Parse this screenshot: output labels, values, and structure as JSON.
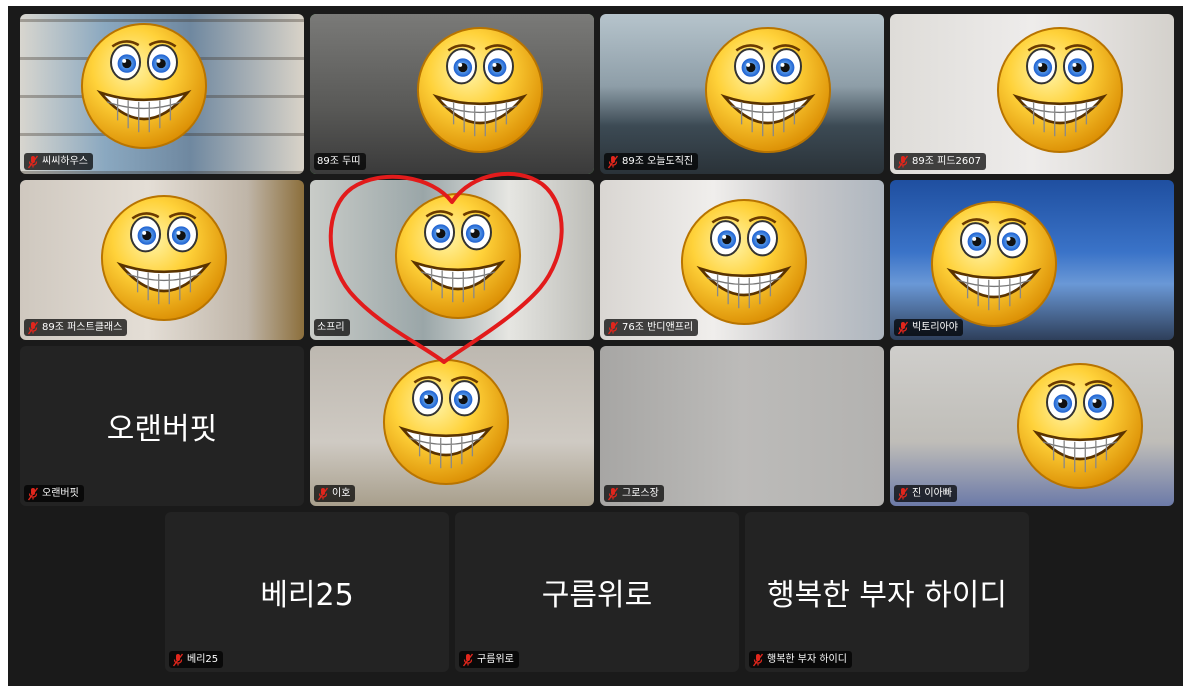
{
  "participants": [
    {
      "name": "씨씨하우스",
      "muted": true,
      "video": true
    },
    {
      "name": "89조 두띠",
      "muted": false,
      "video": true,
      "active_speaker": true
    },
    {
      "name": "89조 오늘도직진",
      "muted": true,
      "video": true
    },
    {
      "name": "89조 피드2607",
      "muted": true,
      "video": true
    },
    {
      "name": "89조 퍼스트클래스",
      "muted": true,
      "video": true
    },
    {
      "name": "소프리",
      "muted": false,
      "video": true
    },
    {
      "name": "76조 반디앤프리",
      "muted": true,
      "video": true
    },
    {
      "name": "빅토리아야",
      "muted": true,
      "video": true
    },
    {
      "name": "오랜버핏",
      "display_name": "오랜버핏",
      "muted": true,
      "video": false
    },
    {
      "name": "이호",
      "muted": true,
      "video": true
    },
    {
      "name": "그로스장",
      "muted": true,
      "video": true
    },
    {
      "name": "진 이아빠",
      "muted": true,
      "video": true
    },
    {
      "name": "베리25",
      "display_name": "베리25",
      "muted": true,
      "video": false
    },
    {
      "name": "구름위로",
      "display_name": "구름위로",
      "muted": true,
      "video": false
    },
    {
      "name": "행복한 부자 하이디",
      "display_name": "행복한 부자 하이디",
      "muted": true,
      "video": false
    }
  ],
  "icons": {
    "muted_mic": "mic-muted-icon",
    "face_cover": "grinning-face-emoji-icon",
    "annotation": "heart-drawing"
  },
  "colors": {
    "stage_bg": "#1a1a1a",
    "tile_bg": "#232323",
    "active_border": "#5ac85c",
    "muted_icon": "#e0261c",
    "heart_stroke": "#e21b1b"
  }
}
